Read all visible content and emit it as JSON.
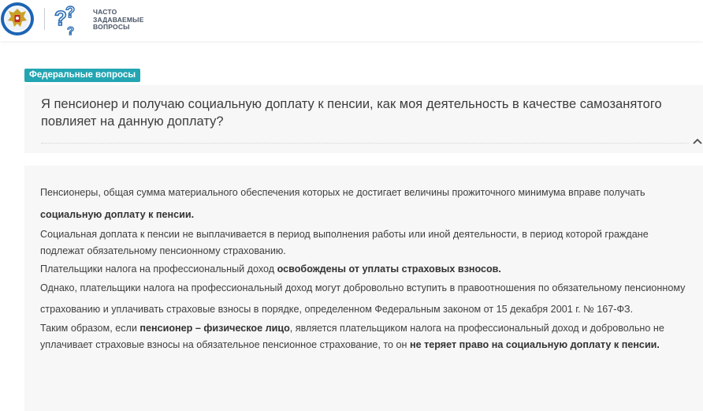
{
  "header": {
    "logo_name": "emblem",
    "faq_icon": "question-marks-icon",
    "title_lines": [
      "ЧАСТО",
      "ЗАДАВАЕМЫЕ",
      "ВОПРОСЫ"
    ]
  },
  "tag": {
    "label": "Федеральные вопросы",
    "color": "#23a5b2"
  },
  "question": {
    "text": "Я пенсионер и получаю социальную доплату к пенсии, как моя деятельность в качестве самозанятого повлияет на данную доплату?",
    "toggle_icon": "chevron-up-icon"
  },
  "answer": {
    "p1_text": "Пенсионеры, общая сумма материального обеспечения которых не достигает величины прожиточного минимума вправе получать",
    "p1_bold": "социальную доплату к пенсии.",
    "p2_text": "Социальная доплата к пенсии не выплачивается в период выполнения работы или иной деятельности, в период которой граждане подлежат обязательному пенсионному страхованию.",
    "p3_text": "Плательщики налога на профессиональный доход ",
    "p3_bold": "освобождены от уплаты страховых взносов.",
    "p4_text": "Однако, плательщики налога на профессиональный доход могут добровольно вступить в правоотношения по обязательному пенсионному страхованию и уплачивать страховые взносы в порядке, определенном Федеральным законом от 15 декабря 2001 г. № 167-ФЗ.",
    "p5_text1": "Таким образом, если ",
    "p5_bold1": "пенсионер – физическое лицо",
    "p5_text2": ", является плательщиком налога на профессиональный доход и добровольно не уплачивает страховые взносы на обязательное пенсионное страхование, то он ",
    "p5_bold2": "не теряет право на социальную доплату к пенсии."
  }
}
